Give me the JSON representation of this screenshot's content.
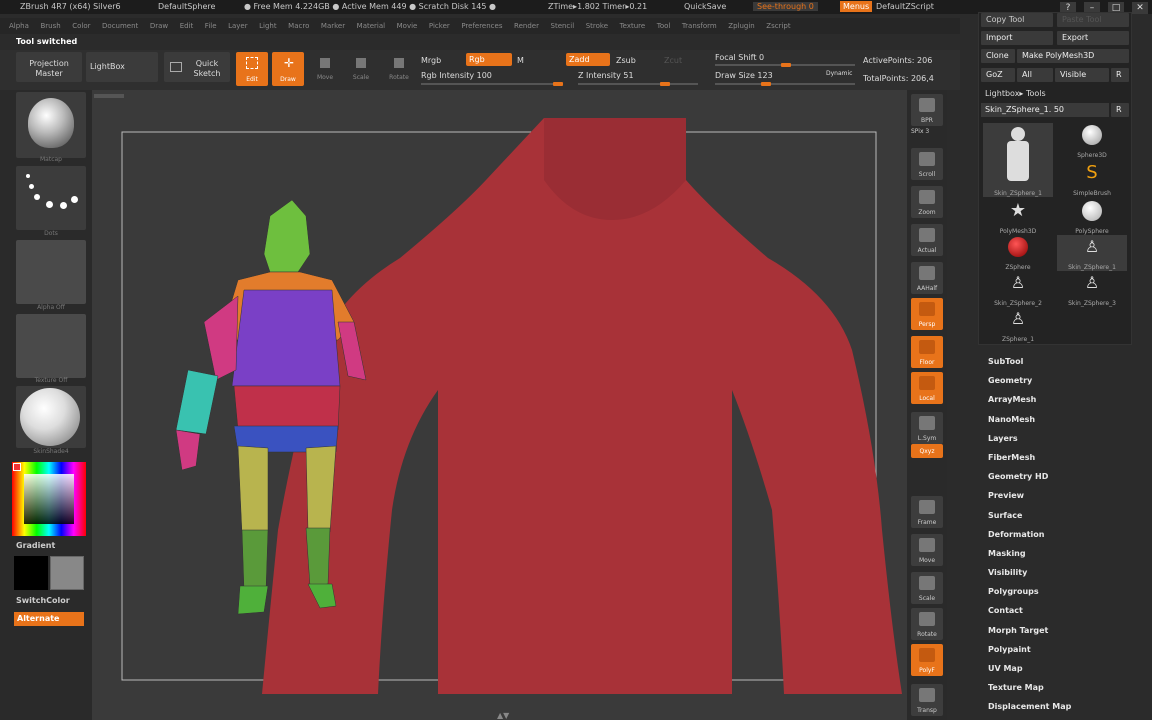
{
  "title_bar": {
    "items": [
      "ZBrush 4R7 (x64) Silver6",
      "DefaultSphere",
      "● Free Mem 4.224GB ● Active Mem 449 ● Scratch Disk 145 ●",
      "ZTime▸1.802 Timer▸0.21",
      "QuickSave",
      "See-through 0",
      "Menus",
      "DefaultZScript"
    ]
  },
  "menu_bar": [
    "Alpha",
    "Brush",
    "Color",
    "Document",
    "Draw",
    "Edit",
    "File",
    "Layer",
    "Light",
    "Macro",
    "Marker",
    "Material",
    "Movie",
    "Picker",
    "Preferences",
    "Render",
    "Stencil",
    "Stroke",
    "Texture",
    "Tool",
    "Transform",
    "Zplugin",
    "Zscript"
  ],
  "status_message": "Tool switched",
  "toolbar": {
    "projection_master": "Projection Master",
    "lightbox": "LightBox",
    "quick_sketch": "Quick Sketch",
    "edit": "Edit",
    "draw": "Draw",
    "move": "Move",
    "scale": "Scale",
    "rotate": "Rotate",
    "mrgb": "Mrgb",
    "rgb": "Rgb",
    "m": "M",
    "rgb_intensity": "Rgb Intensity 100",
    "zadd": "Zadd",
    "zsub": "Zsub",
    "zcut": "Zcut",
    "z_intensity": "Z Intensity 51",
    "focal_shift": "Focal Shift 0",
    "draw_size": "Draw Size 123",
    "dynamic": "Dynamic",
    "active_points": "ActivePoints: 206",
    "total_points": "TotalPoints: 206,4"
  },
  "left_shelf": {
    "material_caption": "Matcap",
    "stroke_caption": "Dots",
    "alpha_caption": "Alpha Off",
    "texture_caption": "Texture Off",
    "skin_caption": "SkinShade4",
    "gradient": "Gradient",
    "switch_color": "SwitchColor",
    "alternate": "Alternate"
  },
  "right_shelf": {
    "bpr": "BPR",
    "spix": "SPix 3",
    "scroll": "Scroll",
    "zoom": "Zoom",
    "actual": "Actual",
    "aahalf": "AAHalf",
    "persp": "Persp",
    "floor": "Floor",
    "local": "Local",
    "lsym": "L.Sym",
    "xyz": "Qxyz",
    "frame": "Frame",
    "move": "Move",
    "scale": "Scale",
    "rotate": "Rotate",
    "polyf": "PolyF",
    "transp": "Transp"
  },
  "tool_panel": {
    "copy_tool": "Copy Tool",
    "paste_tool": "Paste Tool",
    "import": "Import",
    "export": "Export",
    "clone": "Clone",
    "make_polymesh": "Make PolyMesh3D",
    "goz": "GoZ",
    "all": "All",
    "visible": "Visible",
    "r": "R",
    "lightbox_tools": "Lightbox▸ Tools",
    "current_tool": "Skin_ZSphere_1. 50",
    "thumbs": [
      {
        "cap": "Skin_ZSphere_1"
      },
      {
        "cap": "Sphere3D"
      },
      {
        "cap": "SimpleBrush"
      },
      {
        "cap": "PolyMesh3D"
      },
      {
        "cap": "PolySphere"
      },
      {
        "cap": "ZSphere"
      },
      {
        "cap": "Skin_ZSphere_1"
      },
      {
        "cap": "Skin_ZSphere_2"
      },
      {
        "cap": "Skin_ZSphere_3"
      },
      {
        "cap": "ZSphere_1"
      }
    ]
  },
  "menu_list": [
    "SubTool",
    "Geometry",
    "ArrayMesh",
    "NanoMesh",
    "Layers",
    "FiberMesh",
    "Geometry HD",
    "Preview",
    "Surface",
    "Deformation",
    "Masking",
    "Visibility",
    "Polygroups",
    "Contact",
    "Morph Target",
    "Polypaint",
    "UV Map",
    "Texture Map",
    "Displacement Map"
  ],
  "colors": {
    "accent": "#e8731a",
    "model_red": "#a83238",
    "canvas_bg": "#3a3a3a"
  }
}
